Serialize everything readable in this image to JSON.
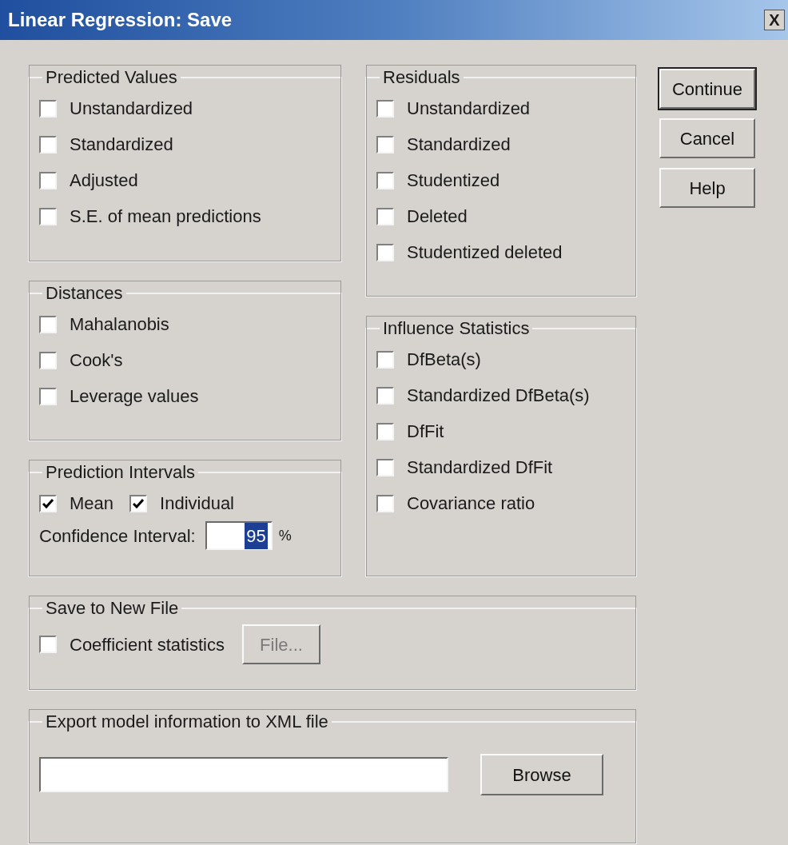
{
  "window": {
    "title": "Linear Regression: Save",
    "close": "X"
  },
  "groups": [
    {
      "title": "Predicted Values",
      "items": [
        {
          "label": "Unstandardized",
          "checked": false
        },
        {
          "label": "Standardized",
          "checked": false
        },
        {
          "label": "Adjusted",
          "checked": false
        },
        {
          "label": "S.E. of mean predictions",
          "checked": false
        }
      ]
    },
    {
      "title": "Distances",
      "items": [
        {
          "label": "Mahalanobis",
          "checked": false
        },
        {
          "label": "Cook's",
          "checked": false
        },
        {
          "label": "Leverage values",
          "checked": false
        }
      ]
    },
    {
      "title": "Residuals",
      "items": [
        {
          "label": "Unstandardized",
          "checked": false
        },
        {
          "label": "Standardized",
          "checked": false
        },
        {
          "label": "Studentized",
          "checked": false
        },
        {
          "label": "Deleted",
          "checked": false
        },
        {
          "label": "Studentized deleted",
          "checked": false
        }
      ]
    },
    {
      "title": "Influence Statistics",
      "items": [
        {
          "label": "DfBeta(s)",
          "checked": false
        },
        {
          "label": "Standardized DfBeta(s)",
          "checked": false
        },
        {
          "label": "DfFit",
          "checked": false
        },
        {
          "label": "Standardized DfFit",
          "checked": false
        },
        {
          "label": "Covariance ratio",
          "checked": false
        }
      ]
    }
  ],
  "prediction_intervals": {
    "title": "Prediction Intervals",
    "items": [
      {
        "label": "Mean",
        "checked": true
      },
      {
        "label": "Individual",
        "checked": true
      }
    ],
    "confidence_label": "Confidence Interval:",
    "confidence_value": "95",
    "value_selected": true,
    "unit": "%"
  },
  "save_to_new_file": {
    "title": "Save to New File",
    "checkbox": {
      "label": "Coefficient statistics",
      "checked": false
    },
    "file_button": {
      "label": "File...",
      "disabled": true
    }
  },
  "export_xml": {
    "title": "Export model information to XML file",
    "browse_button": "Browse"
  },
  "buttons": [
    {
      "label": "Continue",
      "default": true
    },
    {
      "label": "Cancel",
      "default": false
    },
    {
      "label": "Help",
      "default": false
    }
  ]
}
